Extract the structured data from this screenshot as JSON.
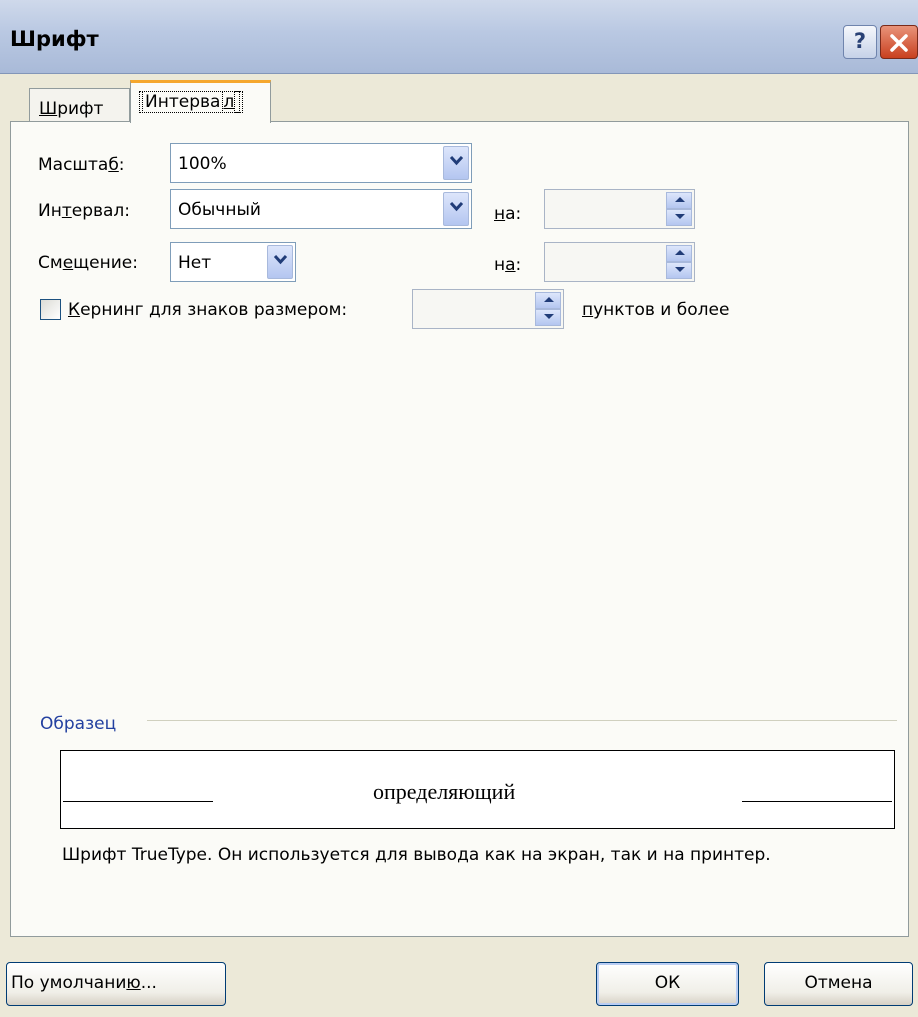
{
  "dialog": {
    "title": "Шрифт",
    "help_label": "?"
  },
  "tabs": [
    {
      "label_pre": "",
      "accel": "Ш",
      "label_post": "рифт"
    },
    {
      "label_pre": "Интерва",
      "accel": "л",
      "label_post": ""
    }
  ],
  "rows": {
    "scale": {
      "label_pre": "Масшта",
      "accel": "б",
      "label_post": ":",
      "value": "100%"
    },
    "spacing": {
      "label_pre": "Ин",
      "accel": "т",
      "label_post": "ервал:",
      "value": "Обычный",
      "by_pre": "",
      "by_accel": "н",
      "by_post": "а:",
      "by_value": ""
    },
    "offset": {
      "label_pre": "См",
      "accel": "е",
      "label_post": "щение:",
      "value": "Нет",
      "by_pre": "н",
      "by_accel": "а",
      "by_post": ":",
      "by_value": ""
    },
    "kerning": {
      "checked": false,
      "label_pre": "",
      "accel": "К",
      "label_post": "ернинг для знаков размером:",
      "value": "",
      "suffix_pre": "",
      "suffix_accel": "п",
      "suffix_post": "унктов и более"
    }
  },
  "sample": {
    "label": "Образец",
    "preview_text": "определяющий",
    "description": "Шрифт TrueType. Он используется для вывода как на экран, так и на принтер."
  },
  "buttons": {
    "default_pre": "По умолчани",
    "default_accel": "ю",
    "default_post": "...",
    "ok": "ОК",
    "cancel": "Отмена"
  },
  "colors": {
    "title_bar": "#b9c8e2",
    "active_tab_accent": "#f5a72e",
    "sample_label": "#2340a0"
  }
}
